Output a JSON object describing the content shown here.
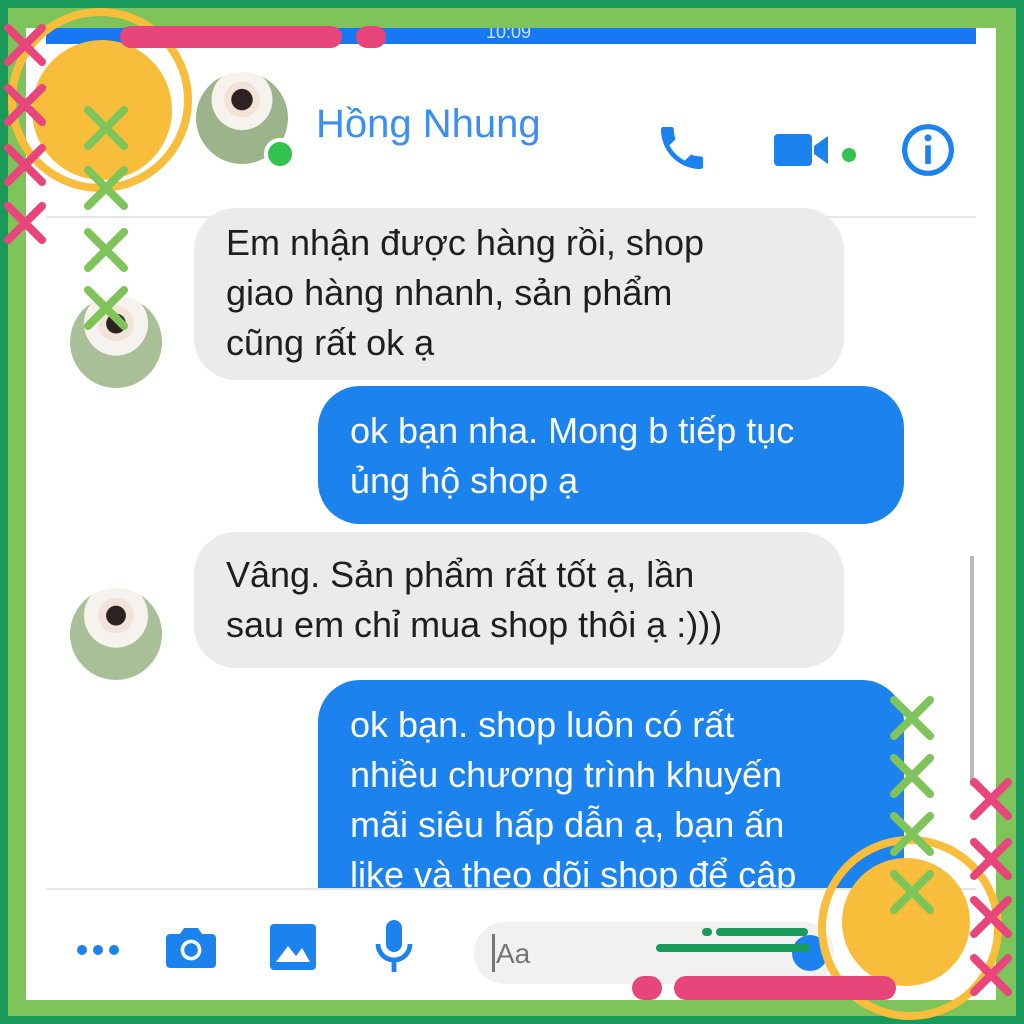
{
  "contact": {
    "name": "Hồng Nhung",
    "online": true
  },
  "status_bar": {
    "time": "10:09"
  },
  "header_icons": [
    "phone-icon",
    "video-camera-icon",
    "info-icon"
  ],
  "messages": [
    {
      "from": "contact",
      "lines": [
        "Em nhận được hàng rồi, shop",
        "giao hàng nhanh, sản phẩm",
        "cũng rất ok ạ"
      ]
    },
    {
      "from": "me",
      "lines": [
        "ok bạn nha. Mong b tiếp tục",
        "ủng hộ shop ạ"
      ]
    },
    {
      "from": "contact",
      "lines": [
        "Vâng. Sản phẩm rất tốt ạ,  lần",
        "sau em chỉ mua shop thôi ạ :)))"
      ]
    },
    {
      "from": "me",
      "lines": [
        "ok bạn. shop luôn có rất",
        "nhiều chương trình khuyến",
        "mãi siêu hấp dẫn ạ,  bạn ấn",
        "like và theo dõi shop để cập"
      ]
    }
  ],
  "composer": {
    "placeholder": "Aa",
    "icons": [
      "more-icon",
      "camera-icon",
      "image-icon",
      "microphone-icon",
      "emoji-icon"
    ]
  },
  "colors": {
    "messenger_blue": "#1877f2",
    "bubble_out": "#1b82ee",
    "bubble_in": "#ebebeb",
    "frame_dark_green": "#1a9a5a",
    "frame_light_green": "#7ec45a",
    "accent_pink": "#e8457a",
    "accent_yellow": "#f7bd3b"
  }
}
